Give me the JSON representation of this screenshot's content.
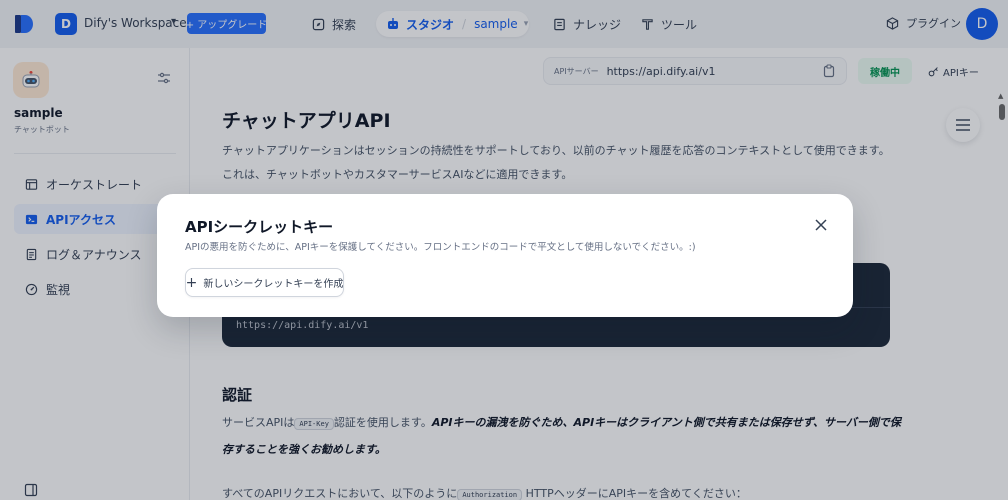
{
  "colors": {
    "accent": "#155eef",
    "running_bg": "#ecfdf3",
    "running_text": "#079455",
    "code_bg": "#1d2939"
  },
  "topbar": {
    "workspace_initial": "D",
    "workspace_name": "Dify's Workspace",
    "upgrade_label": "+ アップグレード",
    "explore_label": "探索",
    "studio_label": "スタジオ",
    "studio_app": "sample",
    "knowledge_label": "ナレッジ",
    "tools_label": "ツール",
    "plugin_label": "プラグイン",
    "user_initial": "D",
    "icons": [
      "compass-icon",
      "robot-icon",
      "book-icon",
      "wrench-icon",
      "cube-icon"
    ]
  },
  "sidebar": {
    "app_name": "sample",
    "app_type": "チャットボット",
    "items": [
      {
        "label": "オーケストレート",
        "icon": "layout-icon"
      },
      {
        "label": "APIアクセス",
        "icon": "terminal-icon",
        "active": true
      },
      {
        "label": "ログ＆アナウンス",
        "icon": "file-icon"
      },
      {
        "label": "監視",
        "icon": "dashboard-icon"
      }
    ]
  },
  "main": {
    "server_label": "APIサーバー",
    "server_url": "https://api.dify.ai/v1",
    "status": "稼働中",
    "api_key_label": "APIキー",
    "doc_title": "チャットアプリAPI",
    "doc_para": "チャットアプリケーションはセッションの持続性をサポートしており、以前のチャット履歴を応答のコンテキストとして使用できます。これは、チャットボットやカスタマーサービスAIなどに適用できます。",
    "code_url": "https://api.dify.ai/v1",
    "auth_heading": "認証",
    "auth_text_1": "サービスAPIは",
    "auth_code": "API-Key",
    "auth_text_2": "認証を使用します。",
    "auth_bold": "APIキーの漏洩を防ぐため、APIキーはクライアント側で共有または保存せず、サーバー側で保存することを強くお勧めします。",
    "bottom_text_1": "すべてのAPIリクエストにおいて、以下のように",
    "bottom_code": "Authorization",
    "bottom_text_2": "HTTPヘッダーにAPIキーを含めてください："
  },
  "modal": {
    "title": "APIシークレットキー",
    "description": "APIの悪用を防ぐために、APIキーを保護してください。フロントエンドのコードで平文として使用しないでください。:)",
    "create_label": "新しいシークレットキーを作成"
  }
}
